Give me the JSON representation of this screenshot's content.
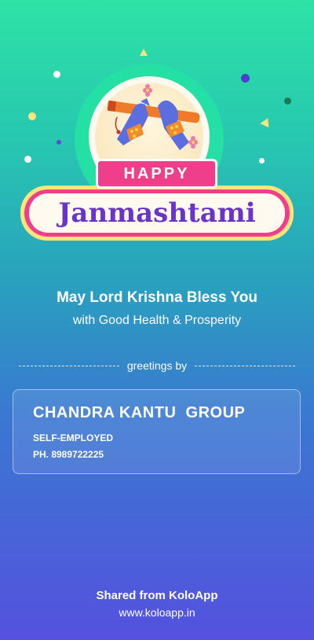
{
  "greeting": {
    "tag": "HAPPY",
    "festival": "Janmashtami",
    "blessing_line1": "May Lord Krishna Bless You",
    "blessing_line2": "with Good Health & Prosperity"
  },
  "divider": {
    "label": "greetings by"
  },
  "sender": {
    "name": "CHANDRA KANTU  GROUP",
    "role": "SELF-EMPLOYED",
    "phone": "PH. 8989722225"
  },
  "footer": {
    "shared_text": "Shared from KoloApp",
    "website": "www.koloapp.in"
  },
  "colors": {
    "pink": "#ef3f8b",
    "purple_text": "#6a34c9",
    "banner_gold": "#ffe47a",
    "gradient_top": "#2ee3a6",
    "gradient_bottom": "#5551de"
  },
  "icons": [
    "flute-hands-illustration",
    "flower-icon",
    "confetti"
  ]
}
